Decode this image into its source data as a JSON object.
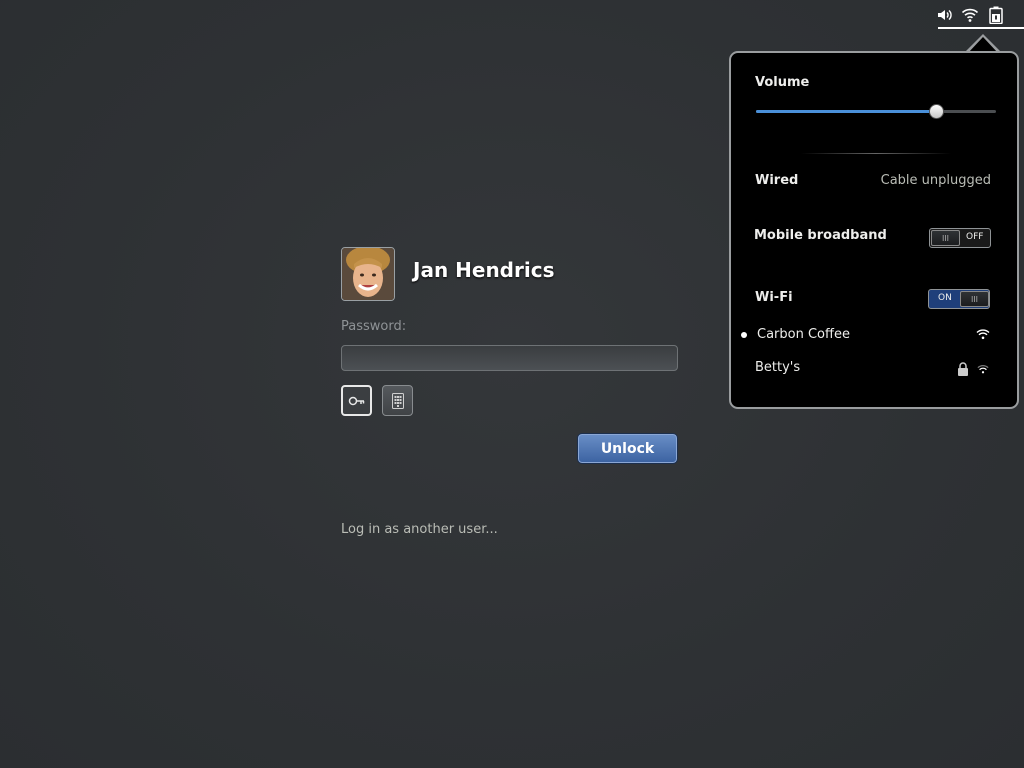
{
  "status_icons": [
    "volume-icon",
    "wifi-icon",
    "battery-icon"
  ],
  "user": {
    "name": "Jan Hendrics"
  },
  "login": {
    "password_label": "Password:",
    "password_value": "",
    "unlock_label": "Unlock",
    "other_user_link": "Log in as another user..."
  },
  "menu": {
    "volume": {
      "label": "Volume",
      "level": 0.75
    },
    "wired": {
      "label": "Wired",
      "status": "Cable unplugged"
    },
    "mobile_broadband": {
      "label": "Mobile broadband",
      "toggle": "OFF"
    },
    "wifi": {
      "label": "Wi-Fi",
      "toggle": "ON"
    },
    "networks": [
      {
        "name": "Carbon Coffee",
        "connected": true,
        "secured": false
      },
      {
        "name": "Betty's",
        "connected": false,
        "secured": true
      }
    ]
  },
  "colors": {
    "accent": "#4a90d9",
    "toggle_on": "#1f3f7a",
    "unlock_button": "#4a6fae"
  }
}
